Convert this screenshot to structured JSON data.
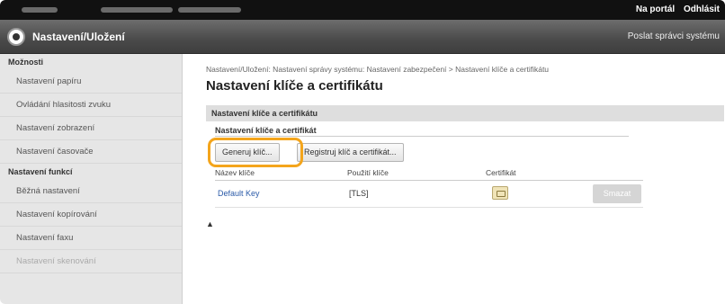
{
  "topbar": {
    "portal_link": "Na portál",
    "logout_link": "Odhlásit"
  },
  "titlebar": {
    "title": "Nastavení/Uložení",
    "admin_link": "Poslat správci systému"
  },
  "sidebar": {
    "group1_title": "Možnosti",
    "group1_items": [
      "Nastavení papíru",
      "Ovládání hlasitosti zvuku",
      "Nastavení zobrazení",
      "Nastavení časovače"
    ],
    "group2_title": "Nastavení funkcí",
    "group2_items": [
      "Běžná nastavení",
      "Nastavení kopírování",
      "Nastavení faxu",
      "Nastavení skenování"
    ]
  },
  "content": {
    "breadcrumb": "Nastavení/Uložení: Nastavení správy systému: Nastavení zabezpečení > Nastavení klíče a certifikátu",
    "page_title": "Nastavení klíče a certifikátu",
    "section_title": "Nastavení klíče a certifikátu",
    "subheading": "Nastavení klíče a certifikát",
    "generate_button": "Generuj klíč...",
    "register_button": "Registruj klíč a certifikát...",
    "table": {
      "headers": [
        "Název klíče",
        "Použití klíče",
        "Certifikát"
      ],
      "rows": [
        {
          "key_name": "Default Key",
          "usage": "[TLS]",
          "delete": "Smazat"
        }
      ]
    },
    "to_top": "▲"
  }
}
